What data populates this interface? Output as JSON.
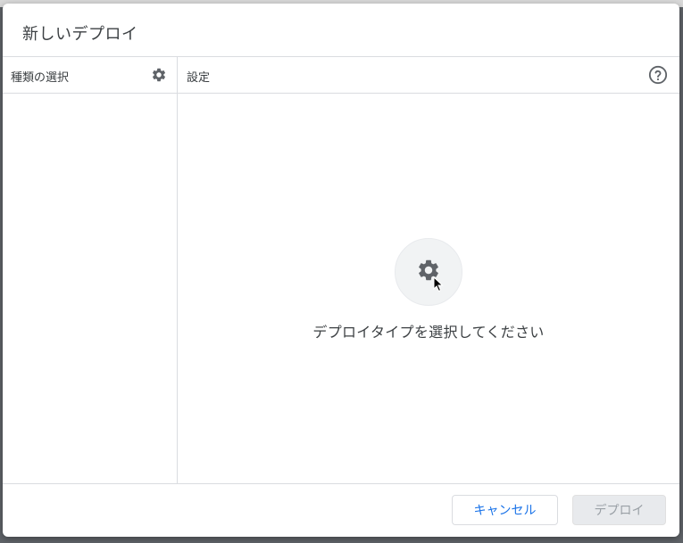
{
  "dialog": {
    "title": "新しいデプロイ"
  },
  "left_panel": {
    "header_label": "種類の選択",
    "header_icon": "gear-icon"
  },
  "right_panel": {
    "header_label": "設定",
    "header_icon": "help-icon",
    "placeholder_icon": "gear-icon",
    "placeholder_text": "デプロイタイプを選択してください"
  },
  "footer": {
    "cancel_label": "キャンセル",
    "deploy_label": "デプロイ",
    "deploy_enabled": false
  },
  "colors": {
    "accent": "#1a73e8",
    "divider": "#dadce0",
    "disabled_bg": "#e8eaed",
    "disabled_text": "#9aa0a6",
    "icon": "#5f6368"
  }
}
